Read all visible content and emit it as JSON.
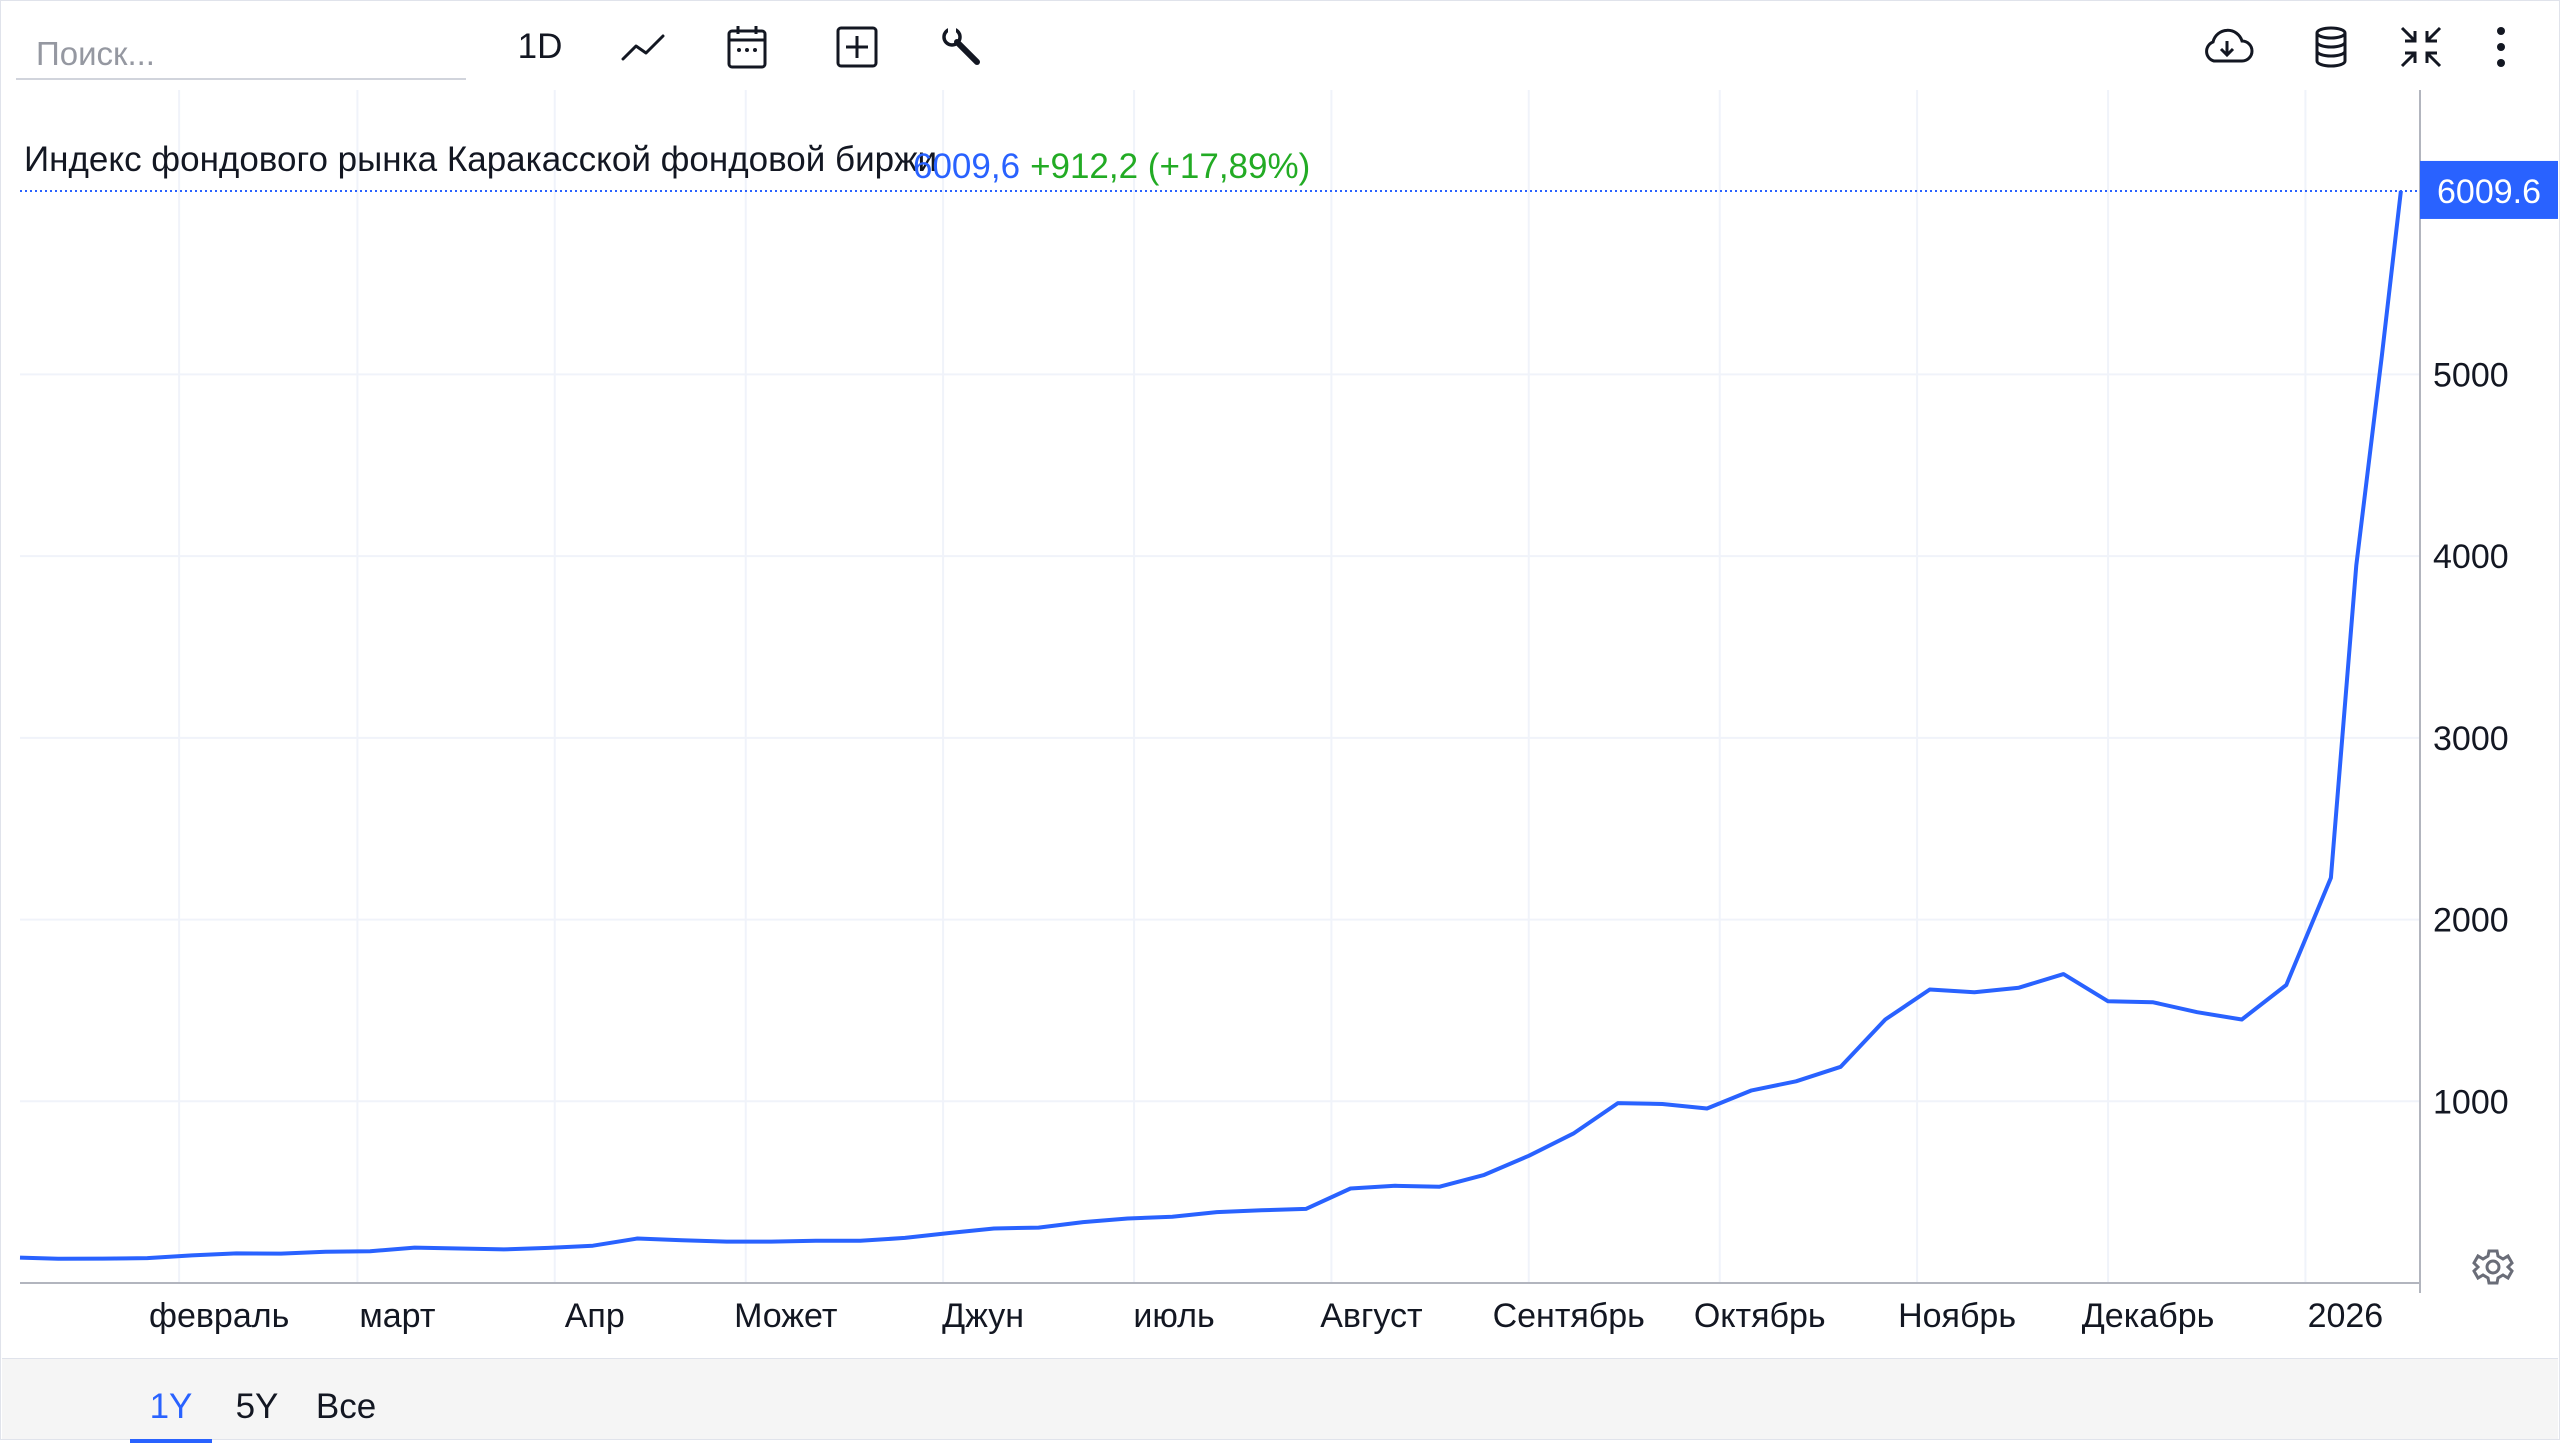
{
  "toolbar": {
    "search_placeholder": "Поиск...",
    "interval": "1D"
  },
  "title": "Индекс фондового рынка Каракасской фондовой биржи",
  "price": {
    "value": "6009,6",
    "change": "+912,2 (+17,89%)",
    "badge": "6009.6"
  },
  "range_tabs": [
    "1Y",
    "5Y",
    "Все"
  ],
  "colors": {
    "line": "#2962ff",
    "positive": "#22ab24",
    "grid": "#f0f3fa",
    "badge_bg": "#2962ff"
  },
  "icons": {
    "chart_type": "line-chart-icon",
    "date_range": "calendar-icon",
    "compare": "add-square-icon",
    "settings": "wrench-icon",
    "download": "cloud-download-icon",
    "data": "database-icon",
    "collapse": "collapse-icon",
    "more": "more-vertical-icon",
    "chart_settings": "gear-icon"
  },
  "chart_data": {
    "type": "line",
    "title": "Индекс фондового рынка Каракасской фондовой биржи",
    "xlabel": "",
    "ylabel": "",
    "ylim": [
      0,
      6400
    ],
    "yticks": [
      1000,
      2000,
      3000,
      4000,
      5000
    ],
    "grid": true,
    "x_tick_labels": [
      "февраль",
      "март",
      "Апр",
      "Может",
      "Джун",
      "июль",
      "Август",
      "Сентябрь",
      "Октябрь",
      "Ноябрь",
      "Декабрь",
      "2026"
    ],
    "x_tick_dates": [
      "2025-02-01",
      "2025-03-01",
      "2025-04-01",
      "2025-05-01",
      "2025-06-01",
      "2025-07-01",
      "2025-08-01",
      "2025-09-01",
      "2025-10-01",
      "2025-11-01",
      "2025-12-01",
      "2026-01-01"
    ],
    "x_range": [
      "2025-01-07",
      "2026-01-19"
    ],
    "last_value": 6009.6,
    "series": [
      {
        "points": [
          [
            "2025-01-07",
            140
          ],
          [
            "2025-01-13",
            133
          ],
          [
            "2025-01-20",
            134
          ],
          [
            "2025-01-27",
            137
          ],
          [
            "2025-02-03",
            152
          ],
          [
            "2025-02-10",
            163
          ],
          [
            "2025-02-17",
            162
          ],
          [
            "2025-02-24",
            172
          ],
          [
            "2025-03-03",
            175
          ],
          [
            "2025-03-10",
            195
          ],
          [
            "2025-03-17",
            190
          ],
          [
            "2025-03-24",
            185
          ],
          [
            "2025-03-31",
            193
          ],
          [
            "2025-04-07",
            205
          ],
          [
            "2025-04-14",
            245
          ],
          [
            "2025-04-21",
            235
          ],
          [
            "2025-04-28",
            228
          ],
          [
            "2025-05-05",
            228
          ],
          [
            "2025-05-12",
            232
          ],
          [
            "2025-05-19",
            232
          ],
          [
            "2025-05-26",
            248
          ],
          [
            "2025-06-02",
            275
          ],
          [
            "2025-06-09",
            300
          ],
          [
            "2025-06-16",
            305
          ],
          [
            "2025-06-23",
            335
          ],
          [
            "2025-06-30",
            355
          ],
          [
            "2025-07-07",
            365
          ],
          [
            "2025-07-14",
            390
          ],
          [
            "2025-07-21",
            400
          ],
          [
            "2025-07-28",
            408
          ],
          [
            "2025-08-04",
            520
          ],
          [
            "2025-08-11",
            535
          ],
          [
            "2025-08-18",
            530
          ],
          [
            "2025-08-25",
            595
          ],
          [
            "2025-09-01",
            700
          ],
          [
            "2025-09-08",
            822
          ],
          [
            "2025-09-15",
            990
          ],
          [
            "2025-09-22",
            985
          ],
          [
            "2025-09-29",
            960
          ],
          [
            "2025-10-06",
            1060
          ],
          [
            "2025-10-13",
            1110
          ],
          [
            "2025-10-20",
            1190
          ],
          [
            "2025-10-27",
            1450
          ],
          [
            "2025-11-03",
            1615
          ],
          [
            "2025-11-10",
            1600
          ],
          [
            "2025-11-17",
            1625
          ],
          [
            "2025-11-24",
            1700
          ],
          [
            "2025-12-01",
            1550
          ],
          [
            "2025-12-08",
            1545
          ],
          [
            "2025-12-15",
            1490
          ],
          [
            "2025-12-22",
            1450
          ],
          [
            "2025-12-29",
            1640
          ],
          [
            "2026-01-05",
            2230
          ],
          [
            "2026-01-09",
            3950
          ],
          [
            "2026-01-13",
            5100
          ],
          [
            "2026-01-16",
            6009.6
          ]
        ]
      }
    ]
  }
}
